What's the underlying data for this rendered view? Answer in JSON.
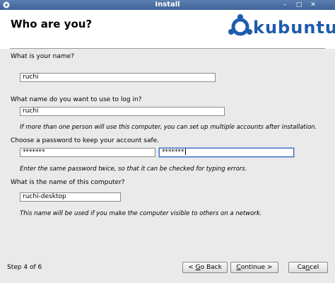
{
  "window": {
    "title": "Install",
    "min_glyph": "–",
    "max_glyph": "□",
    "close_glyph": "✕"
  },
  "header": {
    "title": "Who are you?",
    "logo_text": "kubuntu",
    "logo_color": "#1e5cad"
  },
  "form": {
    "name_label": "What is your name?",
    "name_value": "ruchi",
    "login_label": "What name do you want to use to log in?",
    "login_value": "ruchi",
    "login_hint": "If more than one person will use this computer, you can set up multiple accounts after installation.",
    "password_label": "Choose a password to keep your account safe.",
    "password_value": "*******",
    "password_confirm_value": "*******",
    "password_hint": "Enter the same password twice, so that it can be checked for typing errors.",
    "computer_label": "What is the name of this computer?",
    "computer_value": "ruchi-desktop",
    "computer_hint": "This name will be used if you make the computer visible to others on a network."
  },
  "footer": {
    "step": "Step 4 of 6",
    "back_arrow": "<",
    "back_mnemonic": "G",
    "back_rest": "o Back",
    "continue_mnemonic": "C",
    "continue_rest": "ontinue",
    "continue_arrow": ">",
    "cancel_pre": "Ca",
    "cancel_mnemonic": "n",
    "cancel_rest": "cel"
  }
}
